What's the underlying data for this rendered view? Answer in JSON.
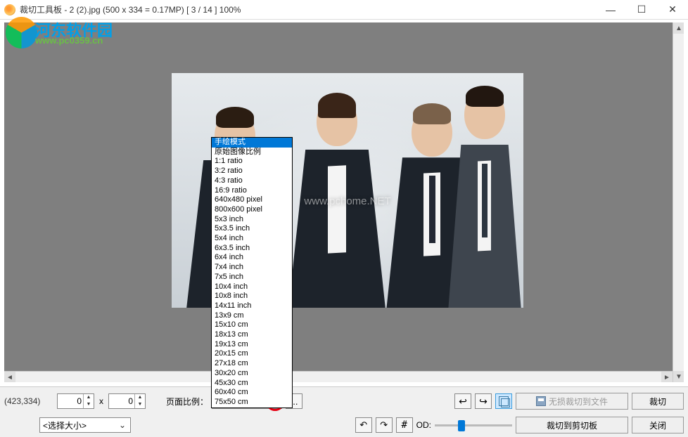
{
  "window": {
    "title": "裁切工具板 - 2 (2).jpg (500 x 334 = 0.17MP) [ 3 / 14 ] 100%",
    "minimize": "—",
    "maximize": "☐",
    "close": "✕"
  },
  "watermark": {
    "site_name": "河东软件园",
    "url": "www.pc0359.cn"
  },
  "image_overlay_url": "www.pchome.NET",
  "dropdown": {
    "items": [
      "手绘模式",
      "原始图像比例",
      "1:1 ratio",
      "3:2 ratio",
      "4:3 ratio",
      "16:9 ratio",
      "640x480 pixel",
      "800x600 pixel",
      "5x3 inch",
      "5x3.5 inch",
      "5x4 inch",
      "6x3.5 inch",
      "6x4 inch",
      "7x4 inch",
      "7x5 inch",
      "10x4 inch",
      "10x8 inch",
      "14x11 inch",
      "13x9 cm",
      "15x10 cm",
      "18x13 cm",
      "19x13 cm",
      "20x15 cm",
      "27x18 cm",
      "30x20 cm",
      "45x30 cm",
      "60x40 cm",
      "75x50 cm"
    ],
    "selected_index": 0
  },
  "toolbar": {
    "coord": "(423,334)",
    "w_value": "0",
    "x_sep": "x",
    "h_value": "0",
    "ratio_label": "页面比例：",
    "ratio_value": "手绘模式",
    "more_btn": "...",
    "prev": "↩",
    "next": "↪",
    "od_label": "OD:",
    "save_label": "无损裁切到文件",
    "crop_label": "裁切",
    "select_size": "<选择大小>",
    "rot_left": "↶",
    "rot_right": "↷",
    "grid": "#",
    "clipboard_label": "裁切到剪切板",
    "close_label": "关闭",
    "scroll_left": "◄",
    "scroll_right": "►",
    "scroll_up": "▲",
    "scroll_down": "▼"
  }
}
